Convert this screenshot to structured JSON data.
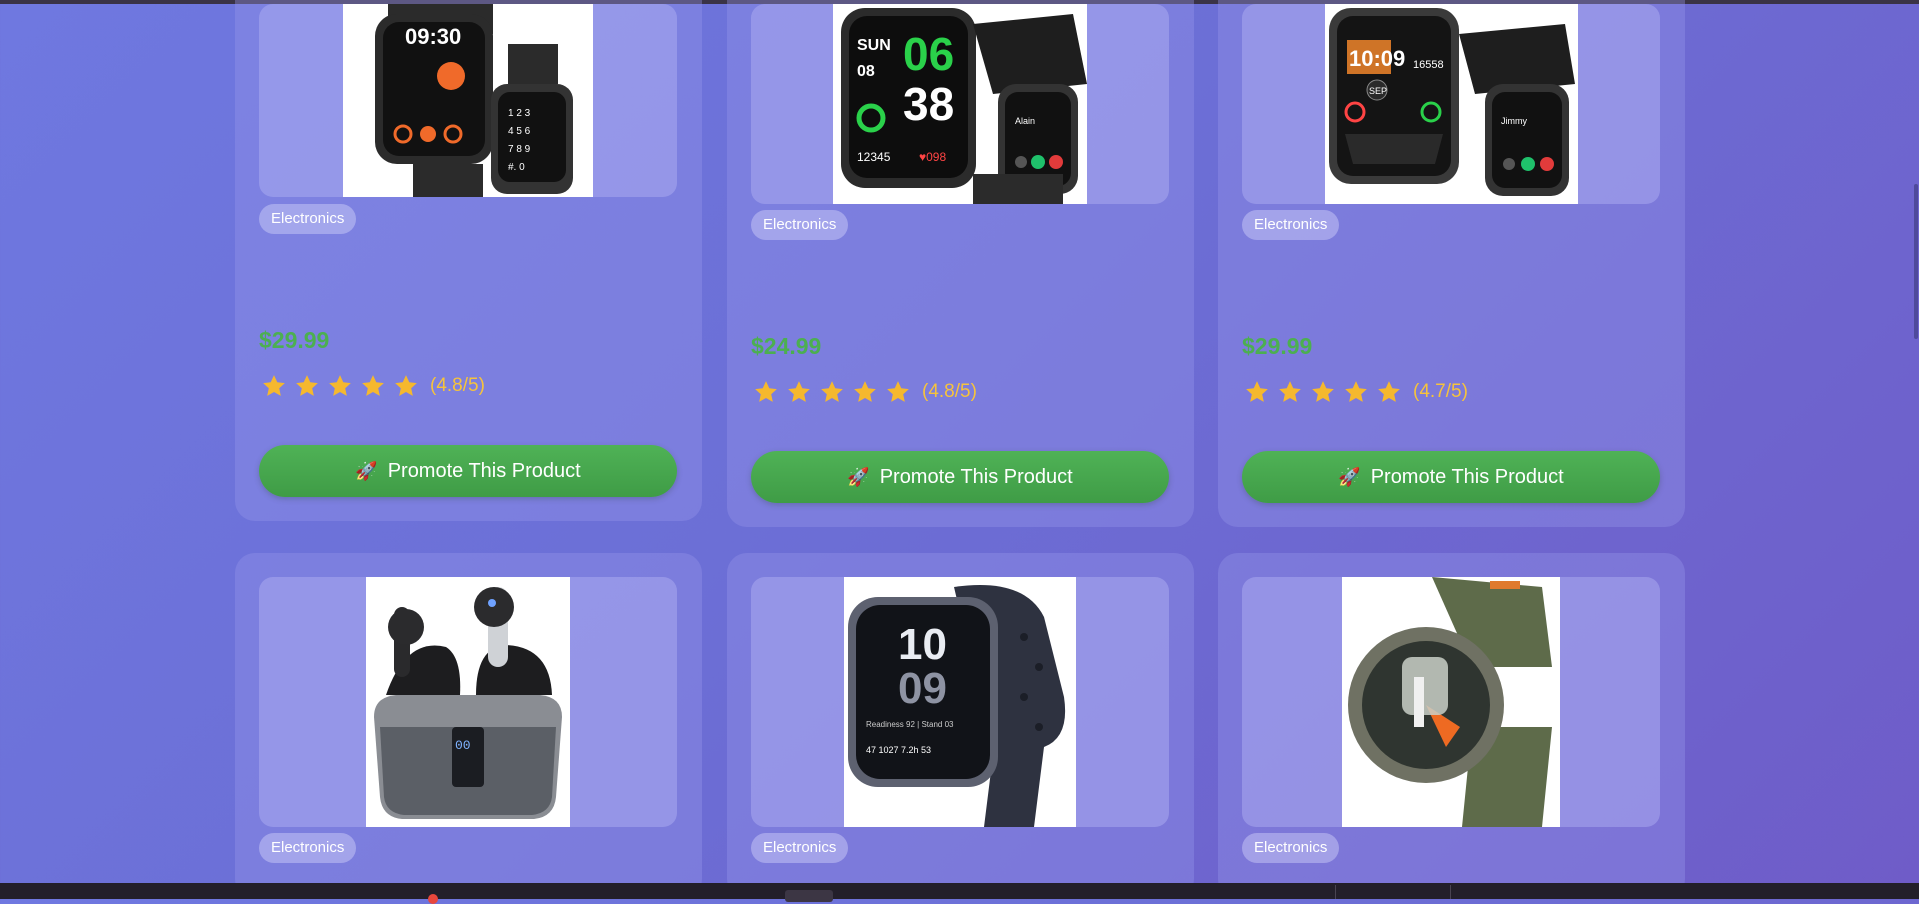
{
  "products": [
    {
      "category": "Electronics",
      "price": "$29.99",
      "rating_text": "(4.8/5)",
      "stars": 5,
      "button": "Promote This Product",
      "image": "smartwatch-black-image"
    },
    {
      "category": "Electronics",
      "price": "$24.99",
      "rating_text": "(4.8/5)",
      "stars": 5,
      "button": "Promote This Product",
      "image": "smartwatch-square-image"
    },
    {
      "category": "Electronics",
      "price": "$29.99",
      "rating_text": "(4.7/5)",
      "stars": 5,
      "button": "Promote This Product",
      "image": "smartwatch-sport-image"
    },
    {
      "category": "Electronics",
      "image": "wireless-earbuds-image"
    },
    {
      "category": "Electronics",
      "image": "smartwatch-grey-image"
    },
    {
      "category": "Electronics",
      "image": "smartwatch-green-image"
    }
  ],
  "colors": {
    "price": "#4caf50",
    "button": "#43a047",
    "rating": "#f6c33c",
    "star": "#f5b82e"
  },
  "icons": {
    "button_icon": "rocket-icon",
    "rating_icon": "star-icon"
  }
}
